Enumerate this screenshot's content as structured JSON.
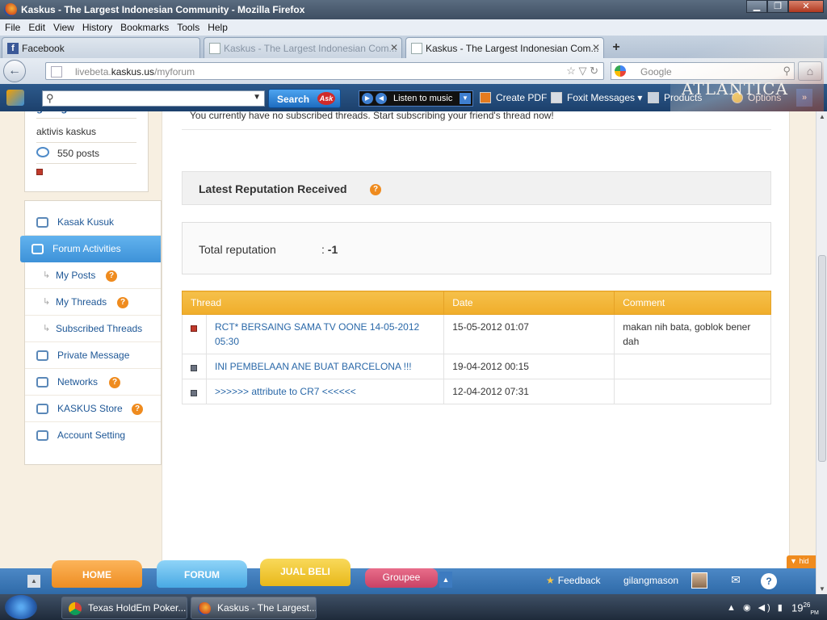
{
  "window": {
    "title": "Kaskus - The Largest Indonesian Community - Mozilla Firefox",
    "min": "▁",
    "max": "❐",
    "close": "✕"
  },
  "menu": [
    "File",
    "Edit",
    "View",
    "History",
    "Bookmarks",
    "Tools",
    "Help"
  ],
  "tabs": [
    {
      "label": "Facebook",
      "favicon": "f"
    },
    {
      "label": "Kaskus - The Largest Indonesian Com...",
      "close": "✕"
    },
    {
      "label": "Kaskus - The Largest Indonesian Com...",
      "close": "✕"
    }
  ],
  "nav": {
    "url_prefix": "livebeta.",
    "url_domain": "kaskus.us",
    "url_path": "/myforum",
    "search_placeholder": "Google",
    "back_glyph": "←",
    "url_icons": "☆ ▽ ↻",
    "search_glyph": "⚲",
    "home_glyph": "⌂",
    "newtab_glyph": "+"
  },
  "toolbar": {
    "search_button": "Search",
    "ask_logo": "Ask",
    "music": "Listen to music",
    "create_pdf": "Create PDF",
    "foxit": "Foxit Messages",
    "products": "Products",
    "options": "Options",
    "more": "»",
    "persona_text": "ATLANTICA"
  },
  "profile": {
    "username": "gilangmason",
    "rank": "aktivis kaskus",
    "posts": "550 posts"
  },
  "sidebar": [
    {
      "label": "Kasak Kusuk",
      "sub": false,
      "active": false,
      "badge": ""
    },
    {
      "label": "Forum Activities",
      "sub": false,
      "active": true,
      "badge": ""
    },
    {
      "label": "My Posts",
      "sub": true,
      "active": false,
      "badge": "?"
    },
    {
      "label": "My Threads",
      "sub": true,
      "active": false,
      "badge": "?"
    },
    {
      "label": "Subscribed Threads",
      "sub": true,
      "active": false,
      "badge": ""
    },
    {
      "label": "Private Message",
      "sub": false,
      "active": false,
      "badge": ""
    },
    {
      "label": "Networks",
      "sub": false,
      "active": false,
      "badge": "?"
    },
    {
      "label": "KASKUS Store",
      "sub": false,
      "active": false,
      "badge": "?"
    },
    {
      "label": "Account Setting",
      "sub": false,
      "active": false,
      "badge": ""
    }
  ],
  "main": {
    "subscribed_notice": "You currently have no subscribed threads. Start subscribing your friend's thread now!",
    "reputation_title": "Latest Reputation Received",
    "reputation_badge": "?",
    "total_label": "Total reputation",
    "total_sep": ":",
    "total_value": "-1",
    "table": {
      "headers": [
        "Thread",
        "Date",
        "Comment"
      ],
      "rows": [
        {
          "mark": "red",
          "thread": "RCT* BERSAING SAMA TV OONE 14-05-2012 05:30",
          "date": "15-05-2012 01:07",
          "comment": "makan nih bata, goblok bener dah"
        },
        {
          "mark": "grey",
          "thread": "INI PEMBELAAN ANE BUAT BARCELONA !!!",
          "date": "19-04-2012 00:15",
          "comment": ""
        },
        {
          "mark": "grey",
          "thread": ">>>>>> attribute to CR7 <<<<<<",
          "date": "12-04-2012 07:31",
          "comment": ""
        }
      ]
    }
  },
  "sitebar": {
    "home": "HOME",
    "forum": "FORUM",
    "jual": "JUAL BELI",
    "groupee": "Groupee",
    "feedback": "Feedback",
    "user": "gilangmason",
    "hide": "▼ hid",
    "collapse": "▲",
    "up": "▲",
    "star": "★",
    "mail": "✉",
    "help": "?"
  },
  "taskbar": {
    "tasks": [
      "Texas HoldEm Poker...",
      "Kaskus - The Largest..."
    ],
    "tray": "▲ ◉ ◀) ▮",
    "clock_h": "19",
    "clock_m": "26",
    "clock_suffix": "PM"
  },
  "colors": {
    "accent": "#ef8b1e",
    "link": "#1e5796",
    "table_header": "#f0ad2a",
    "active_nav": "#3d92d8"
  }
}
